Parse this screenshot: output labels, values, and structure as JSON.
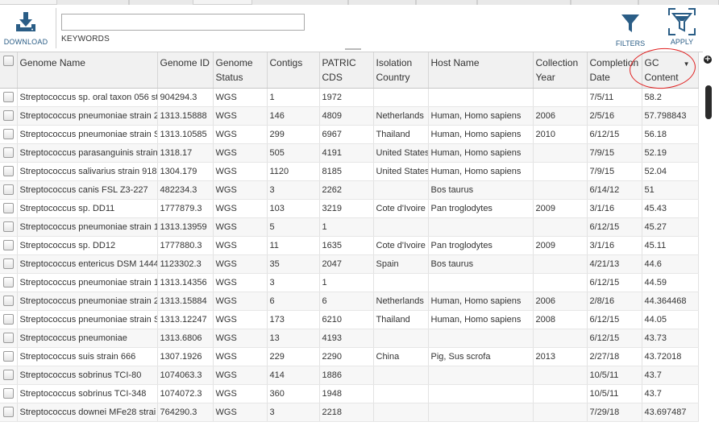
{
  "toolbar": {
    "download_label": "DOWNLOAD",
    "keywords_label": "KEYWORDS",
    "keywords_value": "",
    "filters_label": "FILTERS",
    "apply_label": "APPLY"
  },
  "columns": [
    "Genome Name",
    "Genome ID",
    "Genome Status",
    "Contigs",
    "PATRIC CDS",
    "Isolation Country",
    "Host Name",
    "Collection Year",
    "Completion Date",
    "GC Content"
  ],
  "sort": {
    "column": "GC Content",
    "direction": "descending",
    "icon": "sort-descending-icon"
  },
  "rows": [
    [
      "Streptococcus sp. oral taxon 056 st",
      "904294.3",
      "WGS",
      "1",
      "1972",
      "",
      "",
      "",
      "7/5/11",
      "58.2"
    ],
    [
      "Streptococcus pneumoniae strain 2",
      "1313.15888",
      "WGS",
      "146",
      "4809",
      "Netherlands",
      "Human, Homo sapiens",
      "2006",
      "2/5/16",
      "57.798843"
    ],
    [
      "Streptococcus pneumoniae strain S",
      "1313.10585",
      "WGS",
      "299",
      "6967",
      "Thailand",
      "Human, Homo sapiens",
      "2010",
      "6/12/15",
      "56.18"
    ],
    [
      "Streptococcus parasanguinis strain",
      "1318.17",
      "WGS",
      "505",
      "4191",
      "United States",
      "Human, Homo sapiens",
      "",
      "7/9/15",
      "52.19"
    ],
    [
      "Streptococcus salivarius strain 918",
      "1304.179",
      "WGS",
      "1120",
      "8185",
      "United States",
      "Human, Homo sapiens",
      "",
      "7/9/15",
      "52.04"
    ],
    [
      "Streptococcus canis FSL Z3-227",
      "482234.3",
      "WGS",
      "3",
      "2262",
      "",
      "Bos taurus",
      "",
      "6/14/12",
      "51"
    ],
    [
      "Streptococcus sp. DD11",
      "1777879.3",
      "WGS",
      "103",
      "3219",
      "Cote d'Ivoire",
      "Pan troglodytes",
      "2009",
      "3/1/16",
      "45.43"
    ],
    [
      "Streptococcus pneumoniae strain 1",
      "1313.13959",
      "WGS",
      "5",
      "1",
      "",
      "",
      "",
      "6/12/15",
      "45.27"
    ],
    [
      "Streptococcus sp. DD12",
      "1777880.3",
      "WGS",
      "11",
      "1635",
      "Cote d'Ivoire",
      "Pan troglodytes",
      "2009",
      "3/1/16",
      "45.11"
    ],
    [
      "Streptococcus entericus DSM 1444",
      "1123302.3",
      "WGS",
      "35",
      "2047",
      "Spain",
      "Bos taurus",
      "",
      "4/21/13",
      "44.6"
    ],
    [
      "Streptococcus pneumoniae strain 1",
      "1313.14356",
      "WGS",
      "3",
      "1",
      "",
      "",
      "",
      "6/12/15",
      "44.59"
    ],
    [
      "Streptococcus pneumoniae strain 2",
      "1313.15884",
      "WGS",
      "6",
      "6",
      "Netherlands",
      "Human, Homo sapiens",
      "2006",
      "2/8/16",
      "44.364468"
    ],
    [
      "Streptococcus pneumoniae strain S",
      "1313.12247",
      "WGS",
      "173",
      "6210",
      "Thailand",
      "Human, Homo sapiens",
      "2008",
      "6/12/15",
      "44.05"
    ],
    [
      "Streptococcus pneumoniae",
      "1313.6806",
      "WGS",
      "13",
      "4193",
      "",
      "",
      "",
      "6/12/15",
      "43.73"
    ],
    [
      "Streptococcus suis strain 666",
      "1307.1926",
      "WGS",
      "229",
      "2290",
      "China",
      "Pig, Sus scrofa",
      "2013",
      "2/27/18",
      "43.72018"
    ],
    [
      "Streptococcus sobrinus TCI-80",
      "1074063.3",
      "WGS",
      "414",
      "1886",
      "",
      "",
      "",
      "10/5/11",
      "43.7"
    ],
    [
      "Streptococcus sobrinus TCI-348",
      "1074072.3",
      "WGS",
      "360",
      "1948",
      "",
      "",
      "",
      "10/5/11",
      "43.7"
    ],
    [
      "Streptococcus downei MFe28 strai",
      "764290.3",
      "WGS",
      "3",
      "2218",
      "",
      "",
      "",
      "7/29/18",
      "43.697487"
    ]
  ],
  "icons": {
    "download": "download-icon",
    "filters": "funnel-icon",
    "apply": "funnel-apply-icon",
    "add_column": "add-column-icon"
  },
  "colors": {
    "accent": "#2a5d86",
    "annotation": "#e02020",
    "header_bg": "#f1f1f1"
  }
}
